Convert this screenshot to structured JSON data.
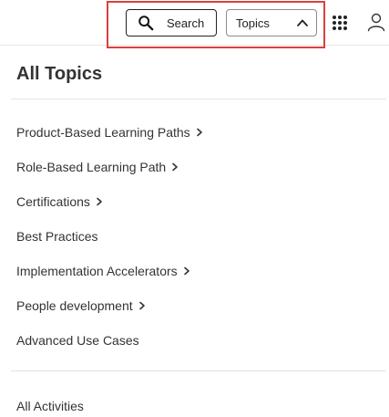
{
  "header": {
    "search_label": "Search",
    "topics_label": "Topics",
    "icons": {
      "search": "search-icon",
      "topics_chevron": "chevron-up-icon",
      "apps": "apps-grid-icon",
      "user": "user-icon"
    },
    "highlight_color": "#d9403f"
  },
  "panel": {
    "title": "All Topics",
    "items": [
      {
        "label": "Product-Based Learning Paths",
        "has_chevron": true
      },
      {
        "label": "Role-Based Learning Path",
        "has_chevron": true
      },
      {
        "label": "Certifications",
        "has_chevron": true
      },
      {
        "label": "Best Practices",
        "has_chevron": false
      },
      {
        "label": "Implementation Accelerators",
        "has_chevron": true
      },
      {
        "label": "People development",
        "has_chevron": true
      },
      {
        "label": "Advanced Use Cases",
        "has_chevron": false
      }
    ],
    "footer_link": "All Activities"
  }
}
